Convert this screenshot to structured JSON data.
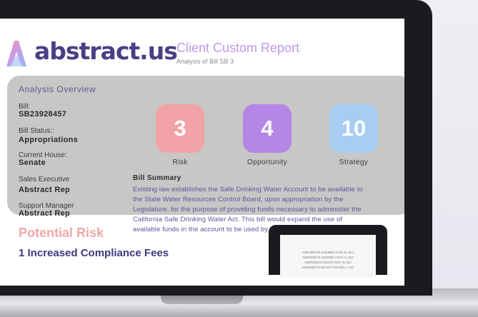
{
  "brand": {
    "name": "abstract.us",
    "report_title": "Client Custom Report",
    "report_subtitle": "Analysis of Bill SB 3"
  },
  "overview": {
    "title": "Analysis Overview",
    "fields": [
      {
        "label": "Bill:",
        "value": "SB23928457"
      },
      {
        "label": "Bill Status::",
        "value": "Appropriations"
      },
      {
        "label": "Current House:",
        "value": "Senate"
      },
      {
        "label": "Sales Executive",
        "value": "Abstract Rep"
      },
      {
        "label": "Support Manager",
        "value": "Abstract Rep"
      }
    ],
    "scores": [
      {
        "value": "3",
        "label": "Risk",
        "color": "#f2a3a7"
      },
      {
        "value": "4",
        "label": "Opportunity",
        "color": "#b487e6"
      },
      {
        "value": "10",
        "label": "Strategy",
        "color": "#a7cdf2"
      }
    ],
    "summary_heading": "Bill Summary",
    "summary_lines": [
      "Existing law establishes the Safe Drinking Water Account to be available to",
      "the State Water Resources Control Board, upon appropriation by the",
      "Legislature, for the purpose of providing funds necessary to administer the",
      "California Safe Drinking Water Act. This bill would expand the use of",
      "available funds in the account to be used by the state board.."
    ]
  },
  "risk": {
    "heading": "Potential Risk",
    "item_title": "1 Increased Compliance Fees"
  },
  "document_preview": {
    "lines": [
      "AMENDED IN ASSEMBLY JUNE 20, 2022",
      "AMENDED IN ASSEMBLY MAY 16, 2022",
      "AMENDED IN SENATE MAY 18, 2021",
      "AMENDED IN SENATE JANUARY 3, 2021"
    ]
  },
  "colors": {
    "brand_purple": "#4a3f86",
    "accent_lavender": "#b99ce8",
    "card_gray": "#c7c7c5",
    "risk_pink": "#f0a8a8"
  }
}
